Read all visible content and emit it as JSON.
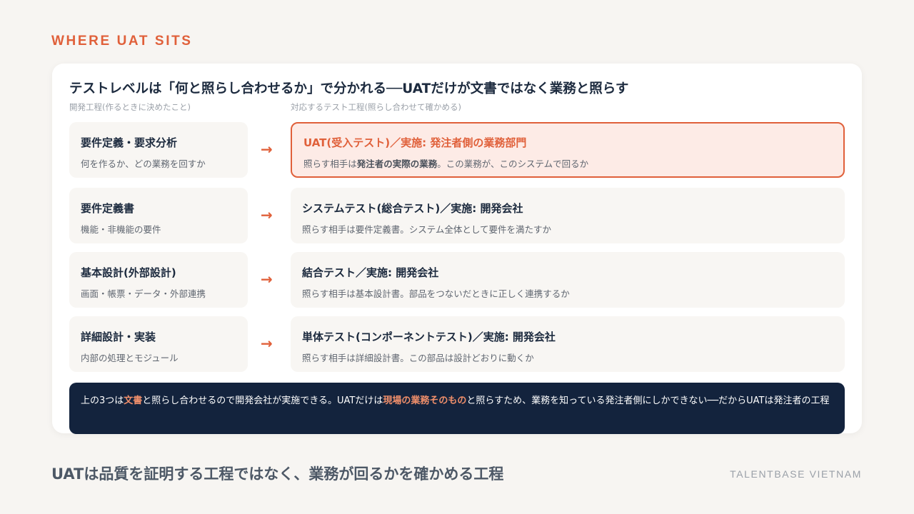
{
  "eyebrow": "WHERE UAT SITS",
  "card": {
    "title": "テストレベルは「何と照らし合わせるか」で分かれる──UATだけが文書ではなく業務と照らす",
    "left_header": "開発工程(作るときに決めたこと)",
    "right_header": "対応するテスト工程(照らし合わせて確かめる)",
    "arrow": "→",
    "rows": [
      {
        "dev_title": "要件定義・要求分析",
        "dev_sub": "何を作るか、どの業務を回すか",
        "test_title": "UAT(受入テスト)／実施: 発注者側の業務部門",
        "test_sub_pre": "照らす相手は",
        "test_sub_bold": "発注者の実際の業務",
        "test_sub_post": "。この業務が、このシステムで回るか"
      },
      {
        "dev_title": "要件定義書",
        "dev_sub": "機能・非機能の要件",
        "test_title": "システムテスト(総合テスト)／実施: 開発会社",
        "test_sub": "照らす相手は要件定義書。システム全体として要件を満たすか"
      },
      {
        "dev_title": "基本設計(外部設計)",
        "dev_sub": "画面・帳票・データ・外部連携",
        "test_title": "結合テスト／実施: 開発会社",
        "test_sub": "照らす相手は基本設計書。部品をつないだときに正しく連携するか"
      },
      {
        "dev_title": "詳細設計・実装",
        "dev_sub": "内部の処理とモジュール",
        "test_title": "単体テスト(コンポーネントテスト)／実施: 開発会社",
        "test_sub": "照らす相手は詳細設計書。この部品は設計どおりに動くか"
      }
    ],
    "note": {
      "p1": "上の3つは",
      "em1": "文書",
      "p2": "と照らし合わせるので開発会社が実施できる。UATだけは",
      "em2": "現場の業務そのもの",
      "p3": "と照らすため、業務を知っている発注者側にしかできない──だからUATは発注者の工程"
    }
  },
  "footer": {
    "tagline": "UATは品質を証明する工程ではなく、業務が回るかを確かめる工程",
    "brand": "TALENTBASE VIETNAM"
  },
  "colors": {
    "accent": "#e0603a",
    "navy": "#13233d",
    "background": "#f7f5f2"
  }
}
